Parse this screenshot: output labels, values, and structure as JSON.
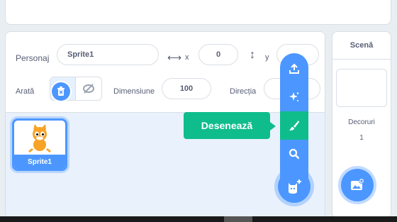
{
  "sprite_info": {
    "sprite_label": "Personaj",
    "sprite_name_value": "Sprite1",
    "x_label": "x",
    "x_value": "0",
    "y_label": "y",
    "show_label": "Arată",
    "size_label": "Dimensiune",
    "size_value": "100",
    "direction_label": "Direcția"
  },
  "sprites": [
    {
      "name": "Sprite1"
    }
  ],
  "stage": {
    "title": "Scenă",
    "backdrops_label": "Decoruri",
    "backdrops_count": "1"
  },
  "add_sprite_menu": {
    "tooltip": "Desenează",
    "items": [
      "upload-icon",
      "surprise-icon",
      "paint-icon",
      "search-icon"
    ]
  },
  "colors": {
    "accent_blue": "#4c97ff",
    "paint_green": "#0fbd8c",
    "text": "#575e75"
  }
}
